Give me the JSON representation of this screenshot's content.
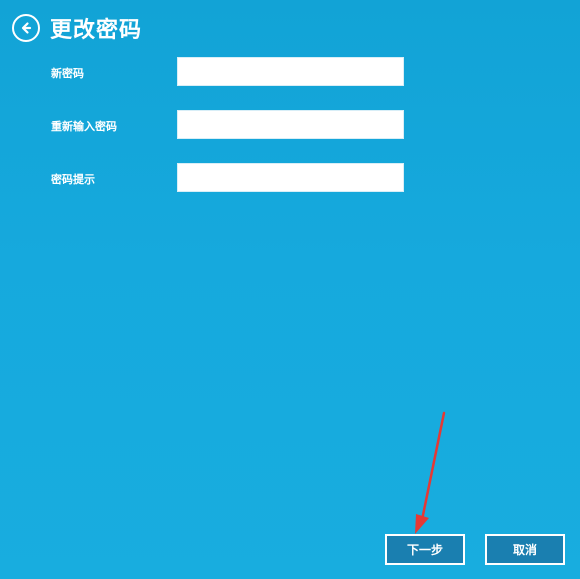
{
  "header": {
    "title": "更改密码",
    "back_icon": "arrow-left-circle-icon"
  },
  "form": {
    "fields": [
      {
        "label": "新密码",
        "value": ""
      },
      {
        "label": "重新输入密码",
        "value": ""
      },
      {
        "label": "密码提示",
        "value": ""
      }
    ]
  },
  "buttons": {
    "next_label": "下一步",
    "cancel_label": "取消"
  },
  "colors": {
    "background": "#16a9dd",
    "button_fill": "#1a7fb0",
    "annotation_arrow": "#e53935"
  }
}
